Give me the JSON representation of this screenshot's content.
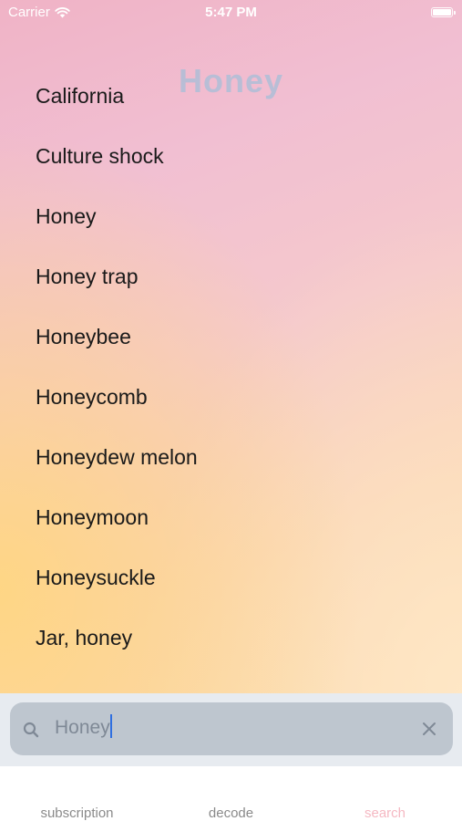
{
  "status_bar": {
    "carrier": "Carrier",
    "time": "5:47 PM",
    "wifi_icon": "wifi-icon",
    "battery_icon": "battery-icon"
  },
  "title": "Honey",
  "results": [
    "California",
    "Culture shock",
    "Honey",
    "Honey trap",
    "Honeybee",
    "Honeycomb",
    "Honeydew melon",
    "Honeymoon",
    "Honeysuckle",
    "Jar, honey"
  ],
  "search": {
    "value": "Honey",
    "search_icon": "search-icon",
    "clear_icon": "clear-icon"
  },
  "tabs": [
    {
      "label": "subscription"
    },
    {
      "label": "decode"
    },
    {
      "label": "search",
      "active": true,
      "active_color": "#f5b8c2"
    }
  ]
}
